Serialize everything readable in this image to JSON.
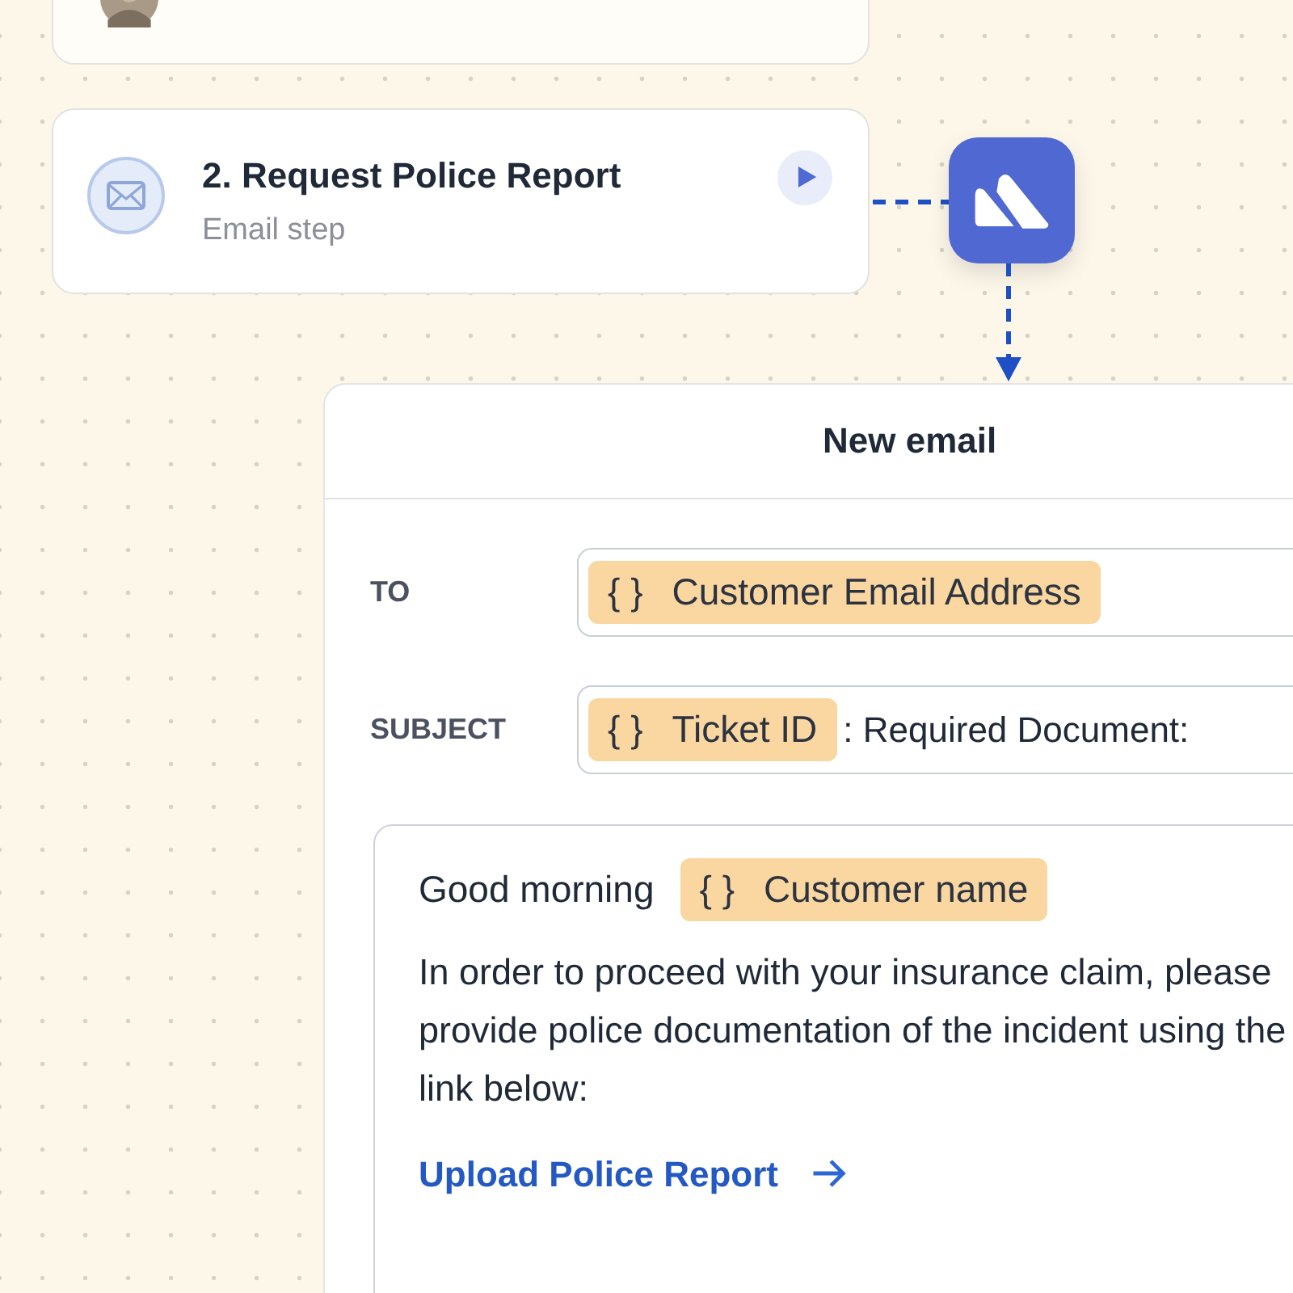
{
  "steps": [
    {
      "kind": "avatar"
    },
    {
      "kind": "email",
      "title": "2. Request Police Report",
      "subtitle": "Email step"
    }
  ],
  "email": {
    "title": "New email",
    "fields": [
      {
        "label": "TO",
        "parts": [
          {
            "kind": "token",
            "icon": "{ }",
            "text": "Customer Email Address"
          }
        ]
      },
      {
        "label": "SUBJECT",
        "parts": [
          {
            "kind": "token",
            "icon": "{ }",
            "text": "Ticket ID"
          },
          {
            "kind": "text",
            "text": ": Required Document:"
          }
        ]
      }
    ],
    "body": {
      "greeting": "Good morning",
      "token": {
        "icon": "{ }",
        "text": "Customer name"
      },
      "paragraph": "In order to proceed with your insurance claim, please provide police documentation of the incident using the link below:",
      "link": "Upload Police Report"
    }
  }
}
